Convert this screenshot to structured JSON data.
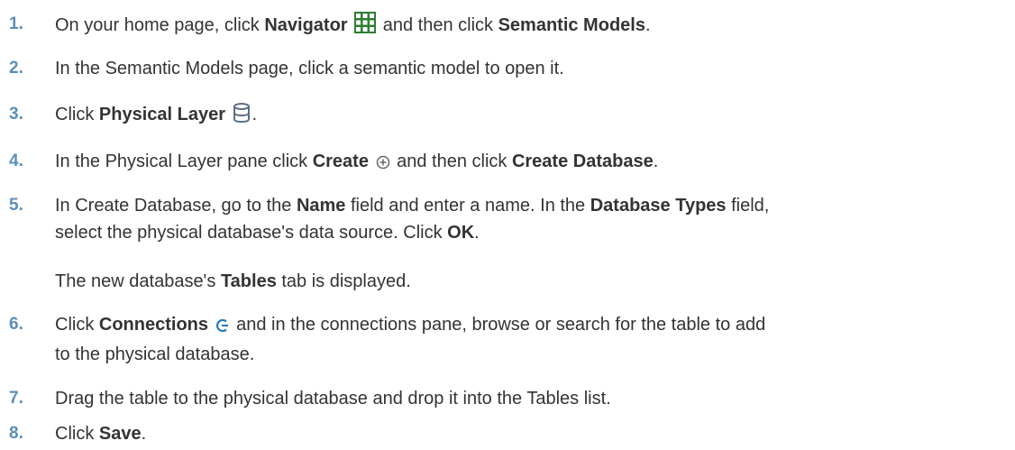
{
  "steps": [
    {
      "number": "1.",
      "parts": {
        "a": "On your home page, click ",
        "b": "Navigator",
        "c": " and then click ",
        "d": "Semantic Models",
        "e": "."
      },
      "icon": "navigator-grid-icon"
    },
    {
      "number": "2.",
      "text": "In the Semantic Models page, click a semantic model to open it."
    },
    {
      "number": "3.",
      "parts": {
        "a": "Click ",
        "b": "Physical Layer",
        "e": "."
      },
      "icon": "database-icon"
    },
    {
      "number": "4.",
      "parts": {
        "a": "In the Physical Layer pane click ",
        "b": "Create",
        "c": " and then click ",
        "d": "Create Database",
        "e": "."
      },
      "icon": "plus-circle-icon"
    },
    {
      "number": "5.",
      "parts": {
        "a": "In Create Database, go to the ",
        "b": "Name",
        "c": " field and enter a name. In the ",
        "d": "Database Types",
        "e": " field,",
        "f": "select the physical database's data source. Click ",
        "g": "OK",
        "h": "."
      },
      "note": {
        "a": "The new database's ",
        "b": "Tables",
        "c": " tab is displayed."
      }
    },
    {
      "number": "6.",
      "parts": {
        "a": "Click ",
        "b": "Connections",
        "c": " and in the connections pane, browse or search for the table to add",
        "d": "to the physical database."
      },
      "icon": "connections-icon"
    },
    {
      "number": "7.",
      "text": "Drag the table to the physical database and drop it into the Tables list."
    },
    {
      "number": "8.",
      "parts": {
        "a": "Click ",
        "b": "Save",
        "c": "."
      }
    }
  ],
  "colors": {
    "step_number": "#5b8fb8",
    "text": "#333333",
    "navigator_icon": "#2e7d32",
    "database_icon": "#5a6f84",
    "create_icon": "#666666",
    "connections_icon": "#2b7bb9"
  }
}
